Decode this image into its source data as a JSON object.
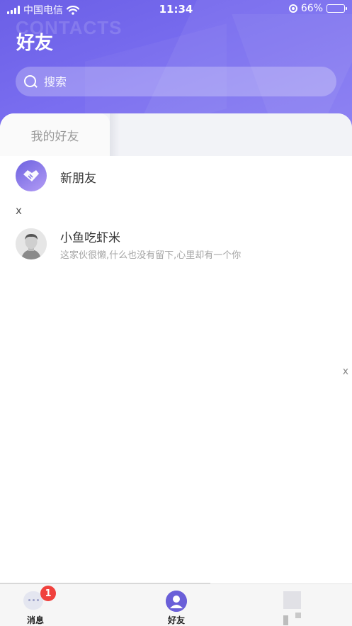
{
  "status_bar": {
    "carrier": "中国电信",
    "time": "11:34",
    "battery": "66%",
    "battery_level": 0.66
  },
  "header": {
    "watermark": "CONTACTS",
    "title": "好友"
  },
  "search": {
    "placeholder": "搜索"
  },
  "tabs": [
    {
      "label": "我的好友",
      "active": true
    }
  ],
  "new_friends": {
    "label": "新朋友"
  },
  "sections": [
    {
      "letter": "X",
      "contacts": [
        {
          "name": "小鱼吃虾米",
          "signature": "这家伙很懒,什么也没有留下,心里却有一个你"
        }
      ]
    }
  ],
  "index_bar": [
    "X"
  ],
  "tabbar": {
    "items": [
      {
        "label": "消息",
        "badge": "1",
        "icon": "message-icon"
      },
      {
        "label": "好友",
        "icon": "friends-icon",
        "active": true
      },
      {
        "label": "",
        "icon": "placeholder-icon"
      }
    ]
  },
  "colors": {
    "header_gradient_start": "#6b5fe6",
    "header_gradient_end": "#8b80f3",
    "badge": "#f0413d"
  }
}
